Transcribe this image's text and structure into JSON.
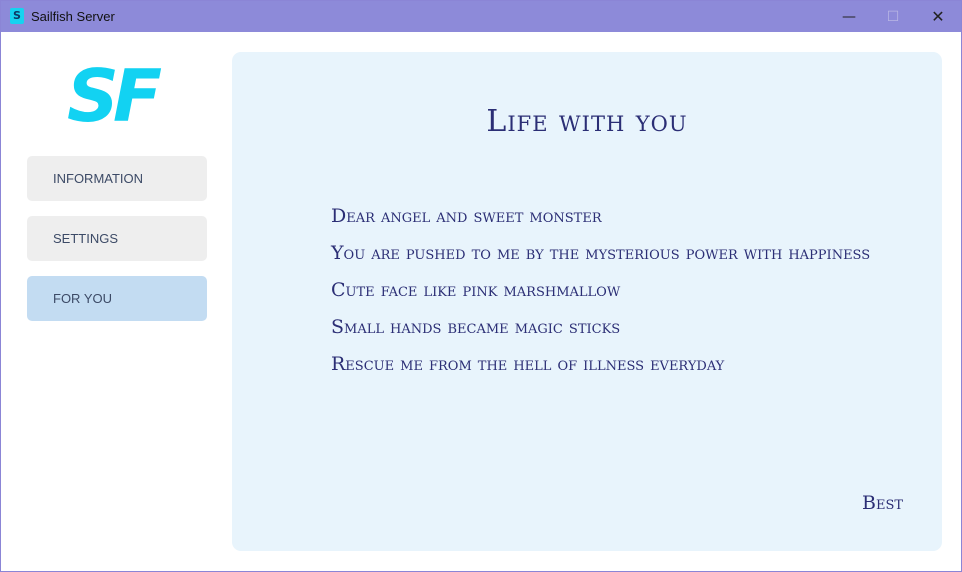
{
  "window": {
    "title": "Sailfish Server",
    "app_icon": "sailfish-app-icon",
    "controls": {
      "minimize": "—",
      "maximize": "☐",
      "close": "✕"
    }
  },
  "brand": {
    "logo_text": "SF",
    "logo_color": "#12d2f2"
  },
  "sidebar": {
    "items": [
      {
        "label": "INFORMATION",
        "active": false
      },
      {
        "label": "SETTINGS",
        "active": false
      },
      {
        "label": "FOR YOU",
        "active": true
      }
    ]
  },
  "content": {
    "title": "Life with you",
    "lines": [
      "Dear angel and sweet monster",
      "You are pushed to me by the mysterious power with happiness",
      "Cute face like pink marshmallow",
      "Small hands became magic sticks",
      "Rescue me from the hell of illness everyday"
    ],
    "signature": "Best"
  },
  "colors": {
    "titlebar": "#8d8ad9",
    "panel_bg": "#e8f4fc",
    "text": "#2b2e75",
    "active_nav": "#c3dcf2"
  }
}
